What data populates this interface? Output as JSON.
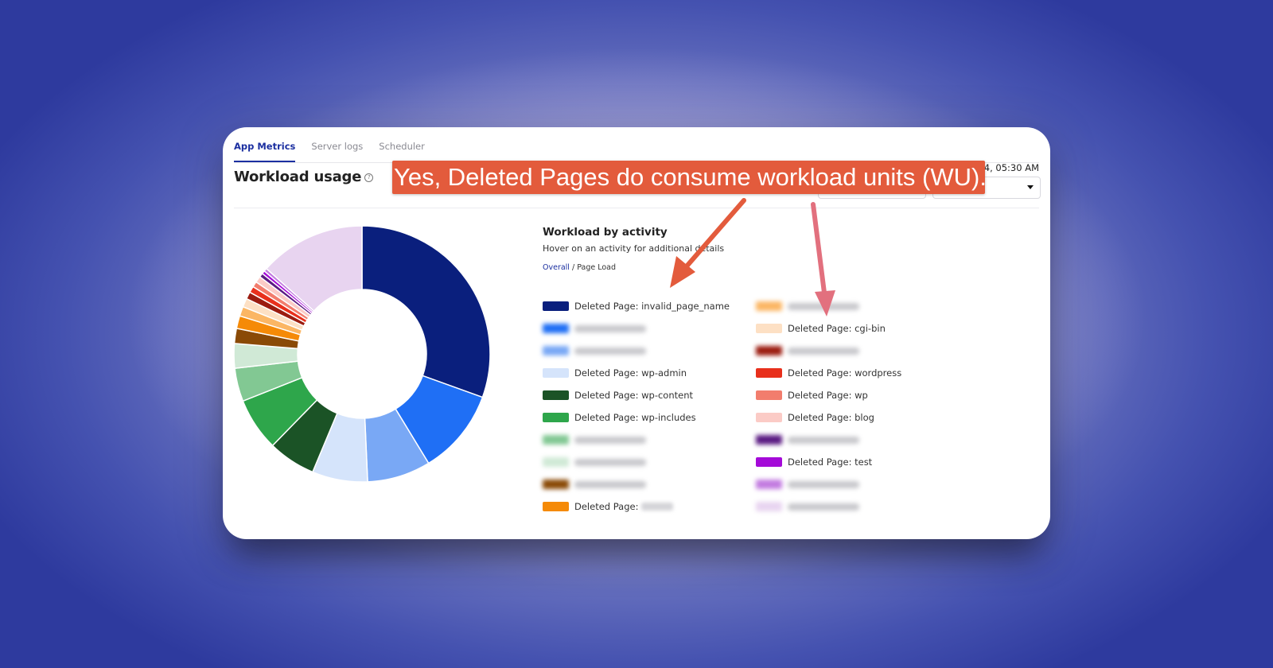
{
  "tabs": [
    {
      "label": "App Metrics",
      "active": true
    },
    {
      "label": "Server logs",
      "active": false
    },
    {
      "label": "Scheduler",
      "active": false
    }
  ],
  "header": {
    "title": "Workload usage",
    "help_icon": "question-circle-icon",
    "timestamp_partial": "24, 05:30 AM"
  },
  "annotation": {
    "banner_text": "Yes, Deleted Pages do consume workload units (WU).",
    "banner_color": "#e35b3c",
    "arrow_colors": [
      "#e35b3c",
      "#e2707e"
    ]
  },
  "legend_header": {
    "title": "Workload by activity",
    "subtitle": "Hover on an activity for additional details",
    "breadcrumb_link": "Overall",
    "breadcrumb_sep": "/",
    "breadcrumb_current": "Page Load"
  },
  "chart_data": {
    "type": "pie",
    "variant": "donut",
    "title": "Workload by activity",
    "units": "percent (estimated)",
    "start": "top, clockwise",
    "slices": [
      {
        "label": "Deleted Page: invalid_page_name",
        "value": 30.5,
        "color": "#0a1f7d",
        "redacted": false
      },
      {
        "label": "[blurred]",
        "value": 10.8,
        "color": "#1f6ff5",
        "redacted": true
      },
      {
        "label": "[blurred]",
        "value": 8.0,
        "color": "#79a8f5",
        "redacted": true
      },
      {
        "label": "Deleted Page: wp-admin",
        "value": 7.0,
        "color": "#d5e4fb",
        "redacted": false
      },
      {
        "label": "Deleted Page: wp-content",
        "value": 6.0,
        "color": "#1b5326",
        "redacted": false
      },
      {
        "label": "Deleted Page: wp-includes",
        "value": 6.7,
        "color": "#2ea64b",
        "redacted": false
      },
      {
        "label": "[blurred]",
        "value": 4.2,
        "color": "#82c893",
        "redacted": true
      },
      {
        "label": "[blurred]",
        "value": 3.1,
        "color": "#d0e9d6",
        "redacted": true
      },
      {
        "label": "[blurred]",
        "value": 1.9,
        "color": "#8a4a06",
        "redacted": true
      },
      {
        "label": "Deleted Page: [blurred]",
        "value": 1.6,
        "color": "#f58a07",
        "redacted": true
      },
      {
        "label": "[blurred]",
        "value": 1.2,
        "color": "#fbb664",
        "redacted": true
      },
      {
        "label": "Deleted Page: cgi-bin",
        "value": 1.1,
        "color": "#fde0c4",
        "redacted": false
      },
      {
        "label": "[blurred]",
        "value": 0.9,
        "color": "#9b1c10",
        "redacted": true
      },
      {
        "label": "Deleted Page: wordpress",
        "value": 0.8,
        "color": "#e8301c",
        "redacted": false
      },
      {
        "label": "Deleted Page: wp",
        "value": 0.7,
        "color": "#f27d6d",
        "redacted": false
      },
      {
        "label": "Deleted Page: blog",
        "value": 0.8,
        "color": "#fbcbc6",
        "redacted": false
      },
      {
        "label": "[blurred]",
        "value": 0.5,
        "color": "#5a1a82",
        "redacted": true
      },
      {
        "label": "Deleted Page: test",
        "value": 0.4,
        "color": "#a40ad8",
        "redacted": false
      },
      {
        "label": "[blurred]",
        "value": 0.4,
        "color": "#c27be0",
        "redacted": true
      },
      {
        "label": "[blurred]",
        "value": 13.4,
        "color": "#e8d4f0",
        "redacted": true
      }
    ]
  },
  "legend": {
    "column1": [
      {
        "text": "Deleted Page: invalid_page_name",
        "color": "#0a1f7d",
        "blurred": false
      },
      {
        "text": "",
        "color": "#1f6ff5",
        "blurred": true
      },
      {
        "text": "",
        "color": "#79a8f5",
        "blurred": true
      },
      {
        "text": "Deleted Page: wp-admin",
        "color": "#d5e4fb",
        "blurred": false
      },
      {
        "text": "Deleted Page: wp-content",
        "color": "#1b5326",
        "blurred": false
      },
      {
        "text": "Deleted Page: wp-includes",
        "color": "#2ea64b",
        "blurred": false
      },
      {
        "text": "",
        "color": "#82c893",
        "blurred": true
      },
      {
        "text": "",
        "color": "#d0e9d6",
        "blurred": true
      },
      {
        "text": "",
        "color": "#8a4a06",
        "blurred": true
      },
      {
        "text": "Deleted Page:",
        "color": "#f58a07",
        "blurred": false,
        "partially_redacted": true
      }
    ],
    "column2": [
      {
        "text": "",
        "color": "#fbb664",
        "blurred": true
      },
      {
        "text": "Deleted Page: cgi-bin",
        "color": "#fde0c4",
        "blurred": false
      },
      {
        "text": "",
        "color": "#9b1c10",
        "blurred": true
      },
      {
        "text": "Deleted Page: wordpress",
        "color": "#e8301c",
        "blurred": false
      },
      {
        "text": "Deleted Page: wp",
        "color": "#f27d6d",
        "blurred": false
      },
      {
        "text": "Deleted Page: blog",
        "color": "#fbcbc6",
        "blurred": false
      },
      {
        "text": "",
        "color": "#5a1a82",
        "blurred": true
      },
      {
        "text": "Deleted Page: test",
        "color": "#a40ad8",
        "blurred": false
      },
      {
        "text": "",
        "color": "#c27be0",
        "blurred": true
      },
      {
        "text": "",
        "color": "#e8d4f0",
        "blurred": true
      }
    ]
  }
}
